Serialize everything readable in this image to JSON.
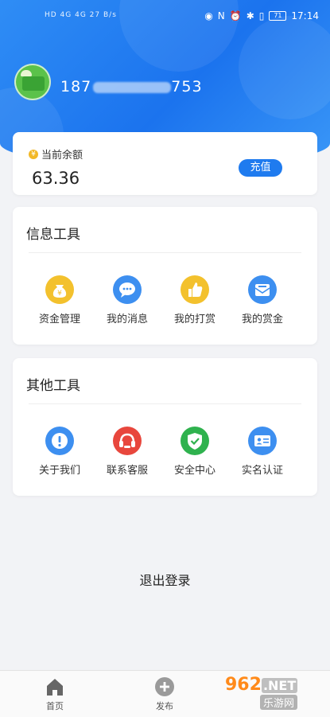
{
  "status_bar": {
    "left_text": "HD 4G 4G 27 B/s",
    "time": "17:14",
    "battery": "71"
  },
  "profile": {
    "phone_prefix": "187",
    "phone_suffix": "753"
  },
  "balance": {
    "label": "当前余额",
    "value": "63.36",
    "recharge_label": "充值"
  },
  "info_tools": {
    "title": "信息工具",
    "items": [
      {
        "label": "资金管理",
        "icon": "money-bag-icon",
        "color": "#f3c12d"
      },
      {
        "label": "我的消息",
        "icon": "chat-bubble-icon",
        "color": "#3d8ff0"
      },
      {
        "label": "我的打赏",
        "icon": "thumbs-up-icon",
        "color": "#f3c12d"
      },
      {
        "label": "我的赏金",
        "icon": "envelope-icon",
        "color": "#3d8ff0"
      }
    ]
  },
  "other_tools": {
    "title": "其他工具",
    "items": [
      {
        "label": "关于我们",
        "icon": "info-icon",
        "color": "#3d8ff0"
      },
      {
        "label": "联系客服",
        "icon": "headset-icon",
        "color": "#e8473d"
      },
      {
        "label": "安全中心",
        "icon": "shield-check-icon",
        "color": "#2fb24e"
      },
      {
        "label": "实名认证",
        "icon": "id-card-icon",
        "color": "#3d8ff0"
      }
    ]
  },
  "logout_label": "退出登录",
  "tabbar": {
    "items": [
      {
        "label": "首页",
        "icon": "home-icon"
      },
      {
        "label": "发布",
        "icon": "plus-circle-icon"
      }
    ]
  },
  "watermark": {
    "top": "962",
    "net": ".NET",
    "bottom": "乐游网"
  }
}
